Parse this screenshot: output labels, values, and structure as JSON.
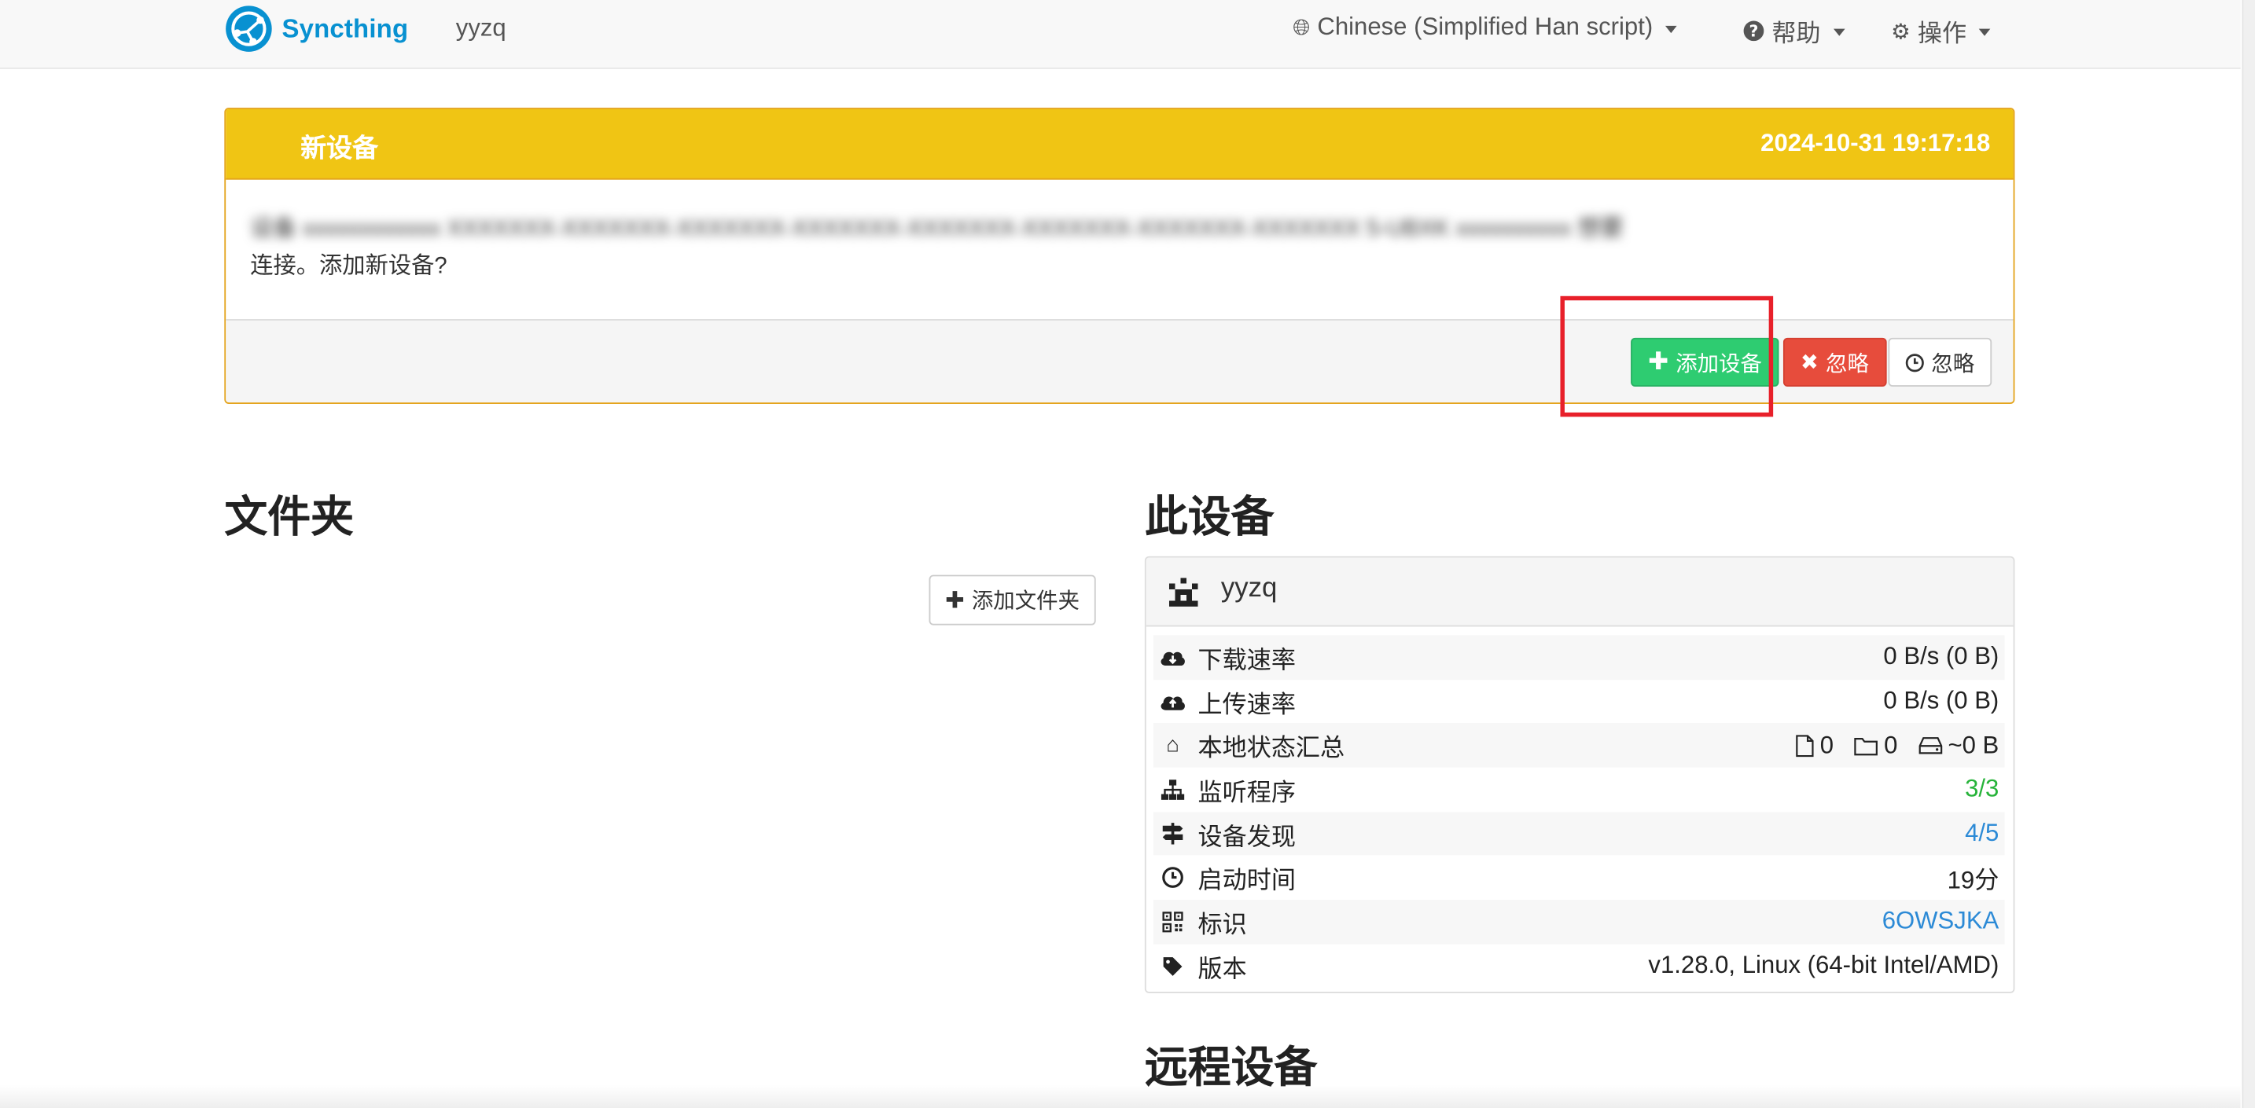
{
  "navbar": {
    "brand": "Syncthing",
    "hostname": "yyzq",
    "language": "Chinese (Simplified Han script)",
    "help": "帮助",
    "actions": "操作"
  },
  "notice": {
    "title": "新设备",
    "time": "2024-10-31 19:17:18",
    "message_line1": "设备 xxxxxxxxxxxx  XXXXXXX-XXXXXXX-XXXXXXX-XXXXXXX-XXXXXXX-XXXXXXX-XXXXXXX-XXXXXXX  5-UBXK xxxxxxxxxx  想要",
    "message_line2": "连接。添加新设备?",
    "add_button": "添加设备",
    "ignore_button": "忽略",
    "later_button": "忽略"
  },
  "folders": {
    "title": "文件夹",
    "add_button": "添加文件夹"
  },
  "this_device": {
    "title": "此设备",
    "name": "yyzq",
    "rows": [
      {
        "icon": "cloud-download-icon",
        "label": "下载速率",
        "value": "0 B/s (0 B)"
      },
      {
        "icon": "cloud-upload-icon",
        "label": "上传速率",
        "value": "0 B/s (0 B)"
      },
      {
        "icon": "home-icon",
        "label": "本地状态汇总",
        "files": "0",
        "dirs": "0",
        "size": "~0 B"
      },
      {
        "icon": "sitemap-icon",
        "label": "监听程序",
        "value": "3/3",
        "color": "#27b33a"
      },
      {
        "icon": "signpost-icon",
        "label": "设备发现",
        "value": "4/5",
        "color": "#2c8ad6"
      },
      {
        "icon": "clock-icon",
        "label": "启动时间",
        "value": "19分"
      },
      {
        "icon": "qrcode-icon",
        "label": "标识",
        "value": "6OWSJKA",
        "color": "#2c8ad6"
      },
      {
        "icon": "tag-icon",
        "label": "版本",
        "value": "v1.28.0, Linux (64-bit Intel/AMD)"
      }
    ]
  },
  "remote_devices": {
    "title": "远程设备"
  }
}
